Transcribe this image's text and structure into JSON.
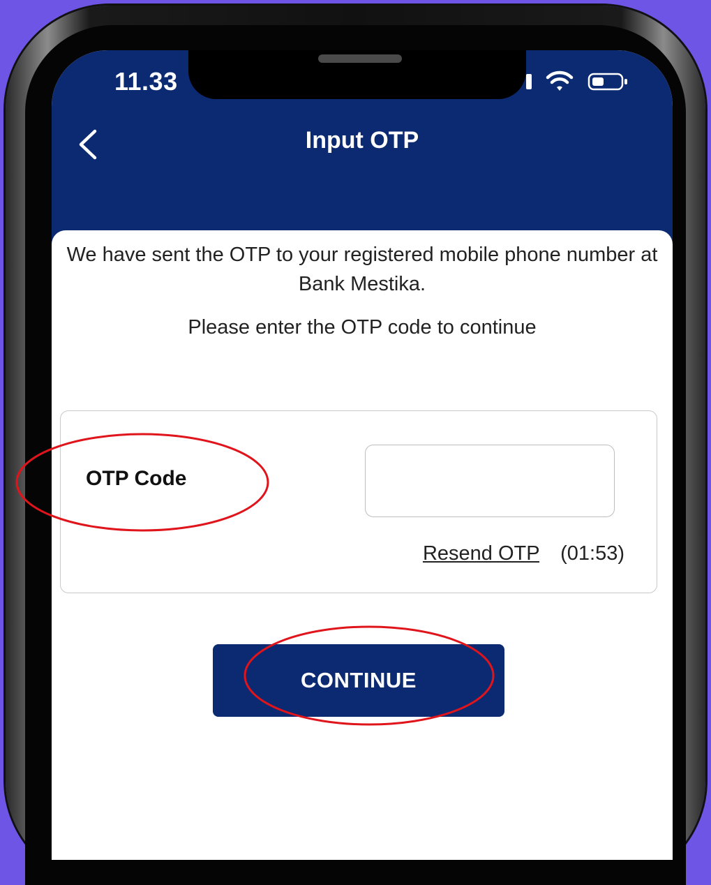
{
  "status_bar": {
    "time": "11.33"
  },
  "header": {
    "title": "Input OTP"
  },
  "content": {
    "intro": "We have sent the OTP to your registered mobile phone number at Bank Mestika.",
    "instruction": "Please enter the OTP code to continue"
  },
  "otp_form": {
    "label": "OTP Code",
    "value": "",
    "resend_label": "Resend OTP",
    "timer": "(01:53)"
  },
  "actions": {
    "continue_label": "CONTINUE"
  },
  "colors": {
    "background": "#6e55e6",
    "header": "#0b2a72",
    "button": "#0b2a72",
    "annotation": "#e0141b"
  },
  "icons": {
    "back": "chevron-left-icon",
    "wifi": "wifi-icon",
    "battery": "battery-icon"
  }
}
